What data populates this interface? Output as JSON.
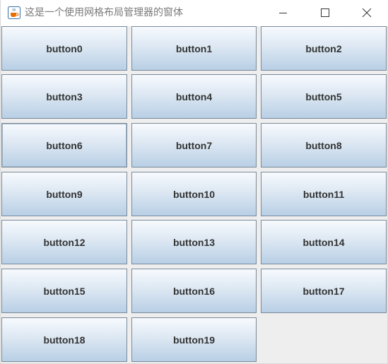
{
  "window": {
    "title": "这是一个使用网格布局管理器的窗体",
    "icon": "java-coffee-icon",
    "controls": [
      "minimize-icon",
      "maximize-icon",
      "close-icon"
    ]
  },
  "buttons": [
    "button0",
    "button1",
    "button2",
    "button3",
    "button4",
    "button5",
    "button6",
    "button7",
    "button8",
    "button9",
    "button10",
    "button11",
    "button12",
    "button13",
    "button14",
    "button15",
    "button16",
    "button17",
    "button18",
    "button19"
  ],
  "focused_button": "button6",
  "colors": {
    "button_border": "#7a8a99",
    "button_gradient_top": "#f7fafe",
    "button_gradient_bottom": "#b8cfe5",
    "window_background": "#eeeeee"
  }
}
